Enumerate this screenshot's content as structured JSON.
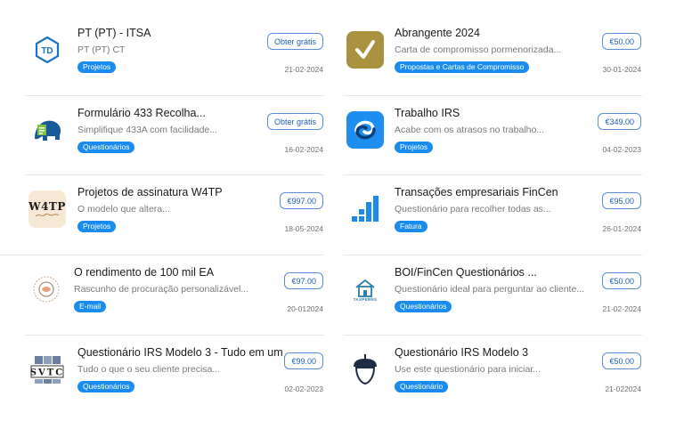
{
  "rows": [
    {
      "left": {
        "title": "PT (PT) - ITSA",
        "desc": "PT (PT) CT",
        "tag": "Projetos",
        "price": "Obter grátis",
        "date": "21-02-2024",
        "logo": "td-hexagon-icon"
      },
      "right": {
        "title": "Abrangente 2024",
        "desc": "Carta de compromisso pormenorizada...",
        "tag": "Propostas e Cartas de Compromisso",
        "price": "€50.00",
        "date": "30-01-2024",
        "logo": "checkmark-icon"
      }
    },
    {
      "left": {
        "title": "Formulário 433 Recolha...",
        "desc": "Simplifique 433A com facilidade...",
        "tag": "Questionários",
        "price": "Obter grátis",
        "date": "16-02-2024",
        "logo": "elephant-icon"
      },
      "right": {
        "title": "Trabalho IRS",
        "desc": "Acabe com os atrasos no trabalho...",
        "tag": "Projetos",
        "price": "€349.00",
        "date": "04-02-2023",
        "logo": "swirl-icon"
      }
    },
    {
      "left": {
        "title": "Projetos de assinatura W4TP",
        "desc": "O modelo que altera...",
        "tag": "Projetos",
        "price": "€997.00",
        "date": "18-05-2024",
        "logo": "w4tp-logo",
        "logo_text": "W4TP"
      },
      "right": {
        "title": "Transações empresariais FinCen",
        "desc": "Questionário para recolher todas as...",
        "tag": "Fatura",
        "price": "€95.00",
        "date": "26-01-2024",
        "logo": "bar-chart-icon"
      }
    },
    {
      "left": {
        "title": "O rendimento de 100 mil EA",
        "desc": "Rascunho de procuração personalizável...",
        "tag": "E-mail",
        "price": "€97.00",
        "date": "20-012024",
        "logo": "circle-seal-icon"
      },
      "right": {
        "title": "BOI/FinCen Questionários ...",
        "desc": "Questionário ideal para perguntar ao cliente...",
        "tag": "Questionários",
        "price": "€50.00",
        "date": "21-02-2024",
        "logo": "house-icon",
        "logo_text": "TAXPERNS"
      }
    },
    {
      "left": {
        "title": "Questionário IRS Modelo 3 - Tudo em um",
        "desc": "Tudo o que o seu cliente precisa...",
        "tag": "Questionários",
        "price": "€99.00",
        "date": "02-02-2023",
        "logo": "svtc-logo",
        "logo_text": "SVTC"
      },
      "right": {
        "title": "Questionário IRS Modelo 3",
        "desc": "Use este questionário para iniciar...",
        "tag": "Questionário",
        "price": "€50.00",
        "date": "21-022024",
        "logo": "acorn-icon"
      }
    }
  ],
  "colors": {
    "tag": "#1a8cf0",
    "button_border": "#5b8fd6",
    "button_text": "#1f5fb5",
    "separator": "#e6e6e6"
  }
}
